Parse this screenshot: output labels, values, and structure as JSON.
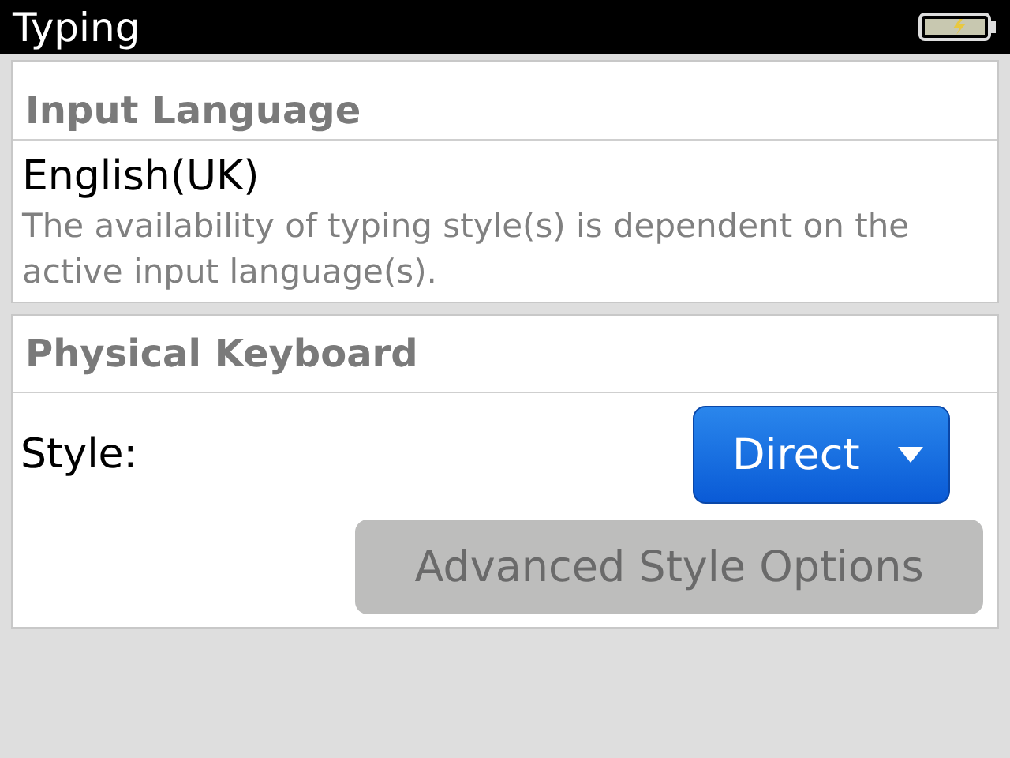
{
  "title_bar": {
    "title": "Typing"
  },
  "sections": [
    {
      "heading": "Input Language",
      "language": "English(UK)",
      "description": "The availability of typing style(s) is dependent on the active input language(s)."
    },
    {
      "heading": "Physical Keyboard",
      "style_label": "Style:",
      "style_dropdown": {
        "value": "Direct",
        "focused": true
      },
      "advanced_button": {
        "label": "Advanced Style Options",
        "focused": false
      }
    }
  ]
}
